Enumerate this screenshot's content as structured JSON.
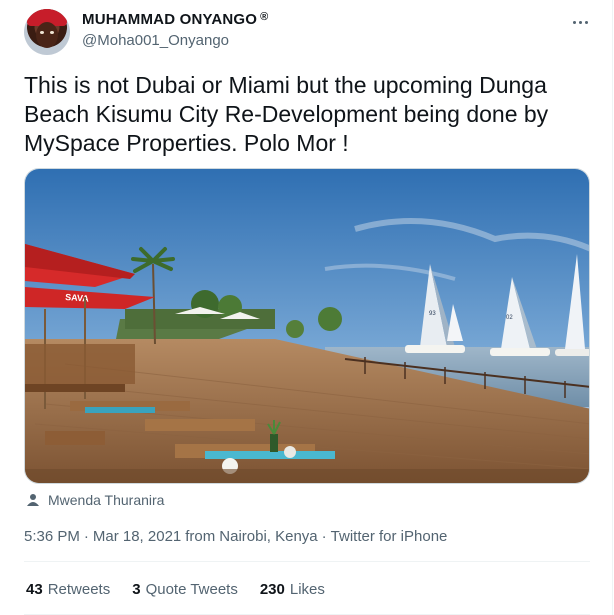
{
  "user": {
    "display_name": "MUHAMMAD ONYANGO",
    "badge": "®",
    "handle": "@Moha001_Onyango"
  },
  "tweet": {
    "text": "This is not Dubai or Miami but the upcoming Dunga Beach Kisumu City Re-Development being done by MySpace Properties. Polo Mor !",
    "image_credit": "Mwenda Thuranira",
    "time": "5:36 PM",
    "date": "Mar 18, 2021",
    "location_prefix": "from",
    "location": "Nairobi, Kenya",
    "separator": "·",
    "client": "Twitter for iPhone"
  },
  "stats": [
    {
      "count": "43",
      "label": "Retweets"
    },
    {
      "count": "3",
      "label": "Quote Tweets"
    },
    {
      "count": "230",
      "label": "Likes"
    }
  ],
  "image_signage": {
    "umbrella_text": "SAVA",
    "sail_numbers": [
      "93",
      "02"
    ]
  },
  "colors": {
    "secondary_text": "#536471",
    "primary_text": "#0f1419",
    "divider": "#eff3f4"
  },
  "icons": {
    "credit": "person-icon",
    "more": "more-horizontal-icon"
  }
}
